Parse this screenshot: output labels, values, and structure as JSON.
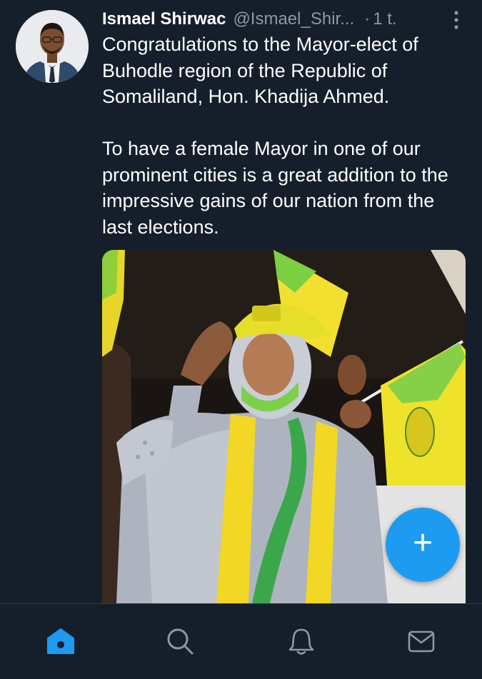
{
  "tweet": {
    "author_name": "Ismael Shirwac",
    "author_handle": "@Ismael_Shir...",
    "separator": "·",
    "time": "1 t.",
    "text_paragraph_1": "Congratulations to the Mayor-elect of Buhodle region of the Republic of Somaliland, Hon. Khadija Ahmed.",
    "text_paragraph_2": "To have a female Mayor in one of our prominent cities is a great addition to the impressive gains of our nation from the last elections.",
    "more_icon": "vertical-ellipsis-icon"
  },
  "compose_button": {
    "label": "+",
    "icon": "plus-icon"
  },
  "bottom_nav": {
    "items": [
      {
        "icon": "home-icon",
        "active": true
      },
      {
        "icon": "search-icon",
        "active": false
      },
      {
        "icon": "bell-icon",
        "active": false
      },
      {
        "icon": "mail-icon",
        "active": false
      }
    ]
  },
  "colors": {
    "background": "#151f2b",
    "text_primary": "#ffffff",
    "text_secondary": "#8b98a5",
    "accent": "#1d9bf0"
  }
}
